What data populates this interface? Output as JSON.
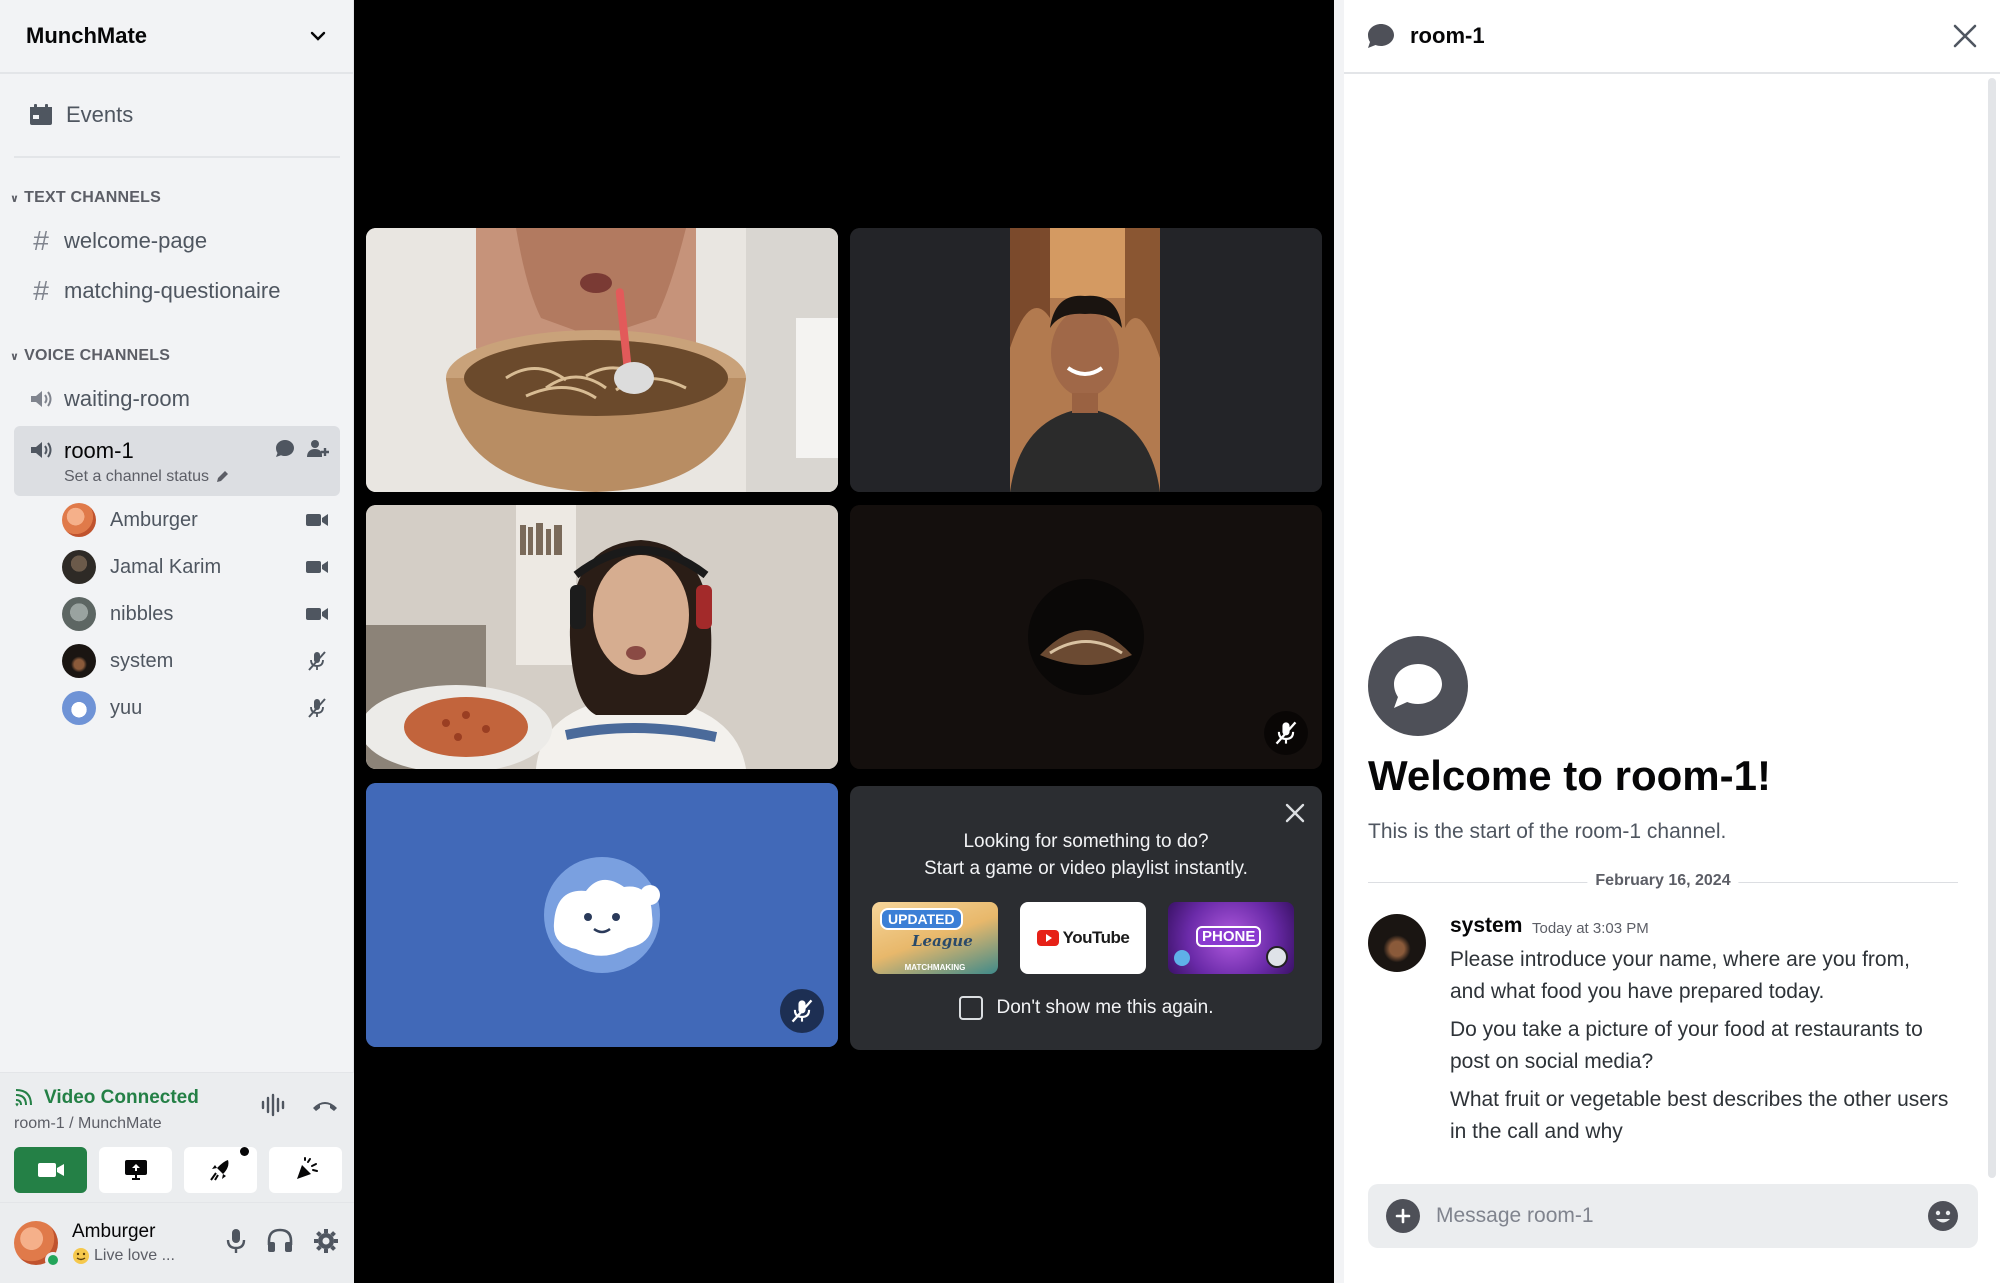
{
  "server": {
    "name": "MunchMate"
  },
  "sidebar": {
    "events_label": "Events",
    "text_category": "TEXT CHANNELS",
    "text_channels": [
      "welcome-page",
      "matching-questionaire"
    ],
    "voice_category": "VOICE CHANNELS",
    "voice_channels": [
      "waiting-room",
      "room-1"
    ],
    "active_channel_status": "Set a channel status",
    "voice_members": [
      {
        "name": "Amburger",
        "state": "camera-icon"
      },
      {
        "name": "Jamal Karim",
        "state": "camera-icon"
      },
      {
        "name": "nibbles",
        "state": "camera-icon"
      },
      {
        "name": "system",
        "state": "mic-muted-icon"
      },
      {
        "name": "yuu",
        "state": "mic-muted-icon"
      }
    ]
  },
  "voice_panel": {
    "status": "Video Connected",
    "location": "room-1 / MunchMate",
    "status_color": "#248046"
  },
  "user_panel": {
    "username": "Amburger",
    "custom_status": "Live love ..."
  },
  "activity_card": {
    "line1": "Looking for something to do?",
    "line2": "Start a game or video playlist instantly.",
    "tile1_badge": "UPDATED",
    "tile1_name": "League",
    "tile1_caption": "MATCHMAKING",
    "tile2_name": "YouTube",
    "tile3_name": "PHONE",
    "checkbox_label": "Don't show me this again."
  },
  "chat": {
    "channel": "room-1",
    "welcome_title": "Welcome to room-1!",
    "welcome_sub": "This is the start of the room-1 channel.",
    "date": "February 16, 2024",
    "message": {
      "author": "system",
      "time": "Today at 3:03 PM",
      "lines": [
        "Please introduce your name, where are you from, and what food you have prepared today.",
        "Do you take a picture of your food at restaurants to post on social media?",
        "What fruit or vegetable best describes the other users in the call and why"
      ]
    },
    "placeholder": "Message room-1"
  },
  "colors": {
    "accent_green": "#248046",
    "sidebar_bg": "#f2f3f5",
    "stage_bg": "#000000",
    "blue_tile": "#4169b8"
  }
}
